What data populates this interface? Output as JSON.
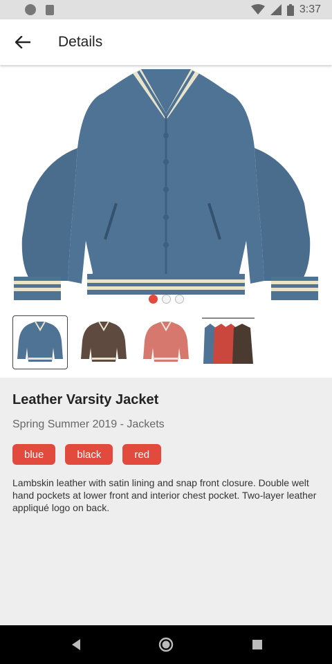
{
  "status_bar": {
    "time": "3:37"
  },
  "app_bar": {
    "title": "Details"
  },
  "gallery": {
    "active_index": 0,
    "dot_count": 3,
    "thumbnails": [
      "blue-jacket",
      "black-jacket",
      "red-jacket",
      "jackets-on-rack"
    ],
    "selected_thumbnail": 0
  },
  "product": {
    "title": "Leather Varsity Jacket",
    "subtitle": "Spring Summer 2019 - Jackets",
    "colors": [
      "blue",
      "black",
      "red"
    ],
    "description": "Lambskin leather with satin lining and snap front closure. Double welt hand pockets at lower front and interior chest pocket. Two-layer leather appliqué logo on back."
  },
  "theme": {
    "accent": "#e24a3e",
    "jacket_blue": "#4f7394",
    "jacket_brown": "#5e4a3e",
    "jacket_red": "#d7786f"
  }
}
